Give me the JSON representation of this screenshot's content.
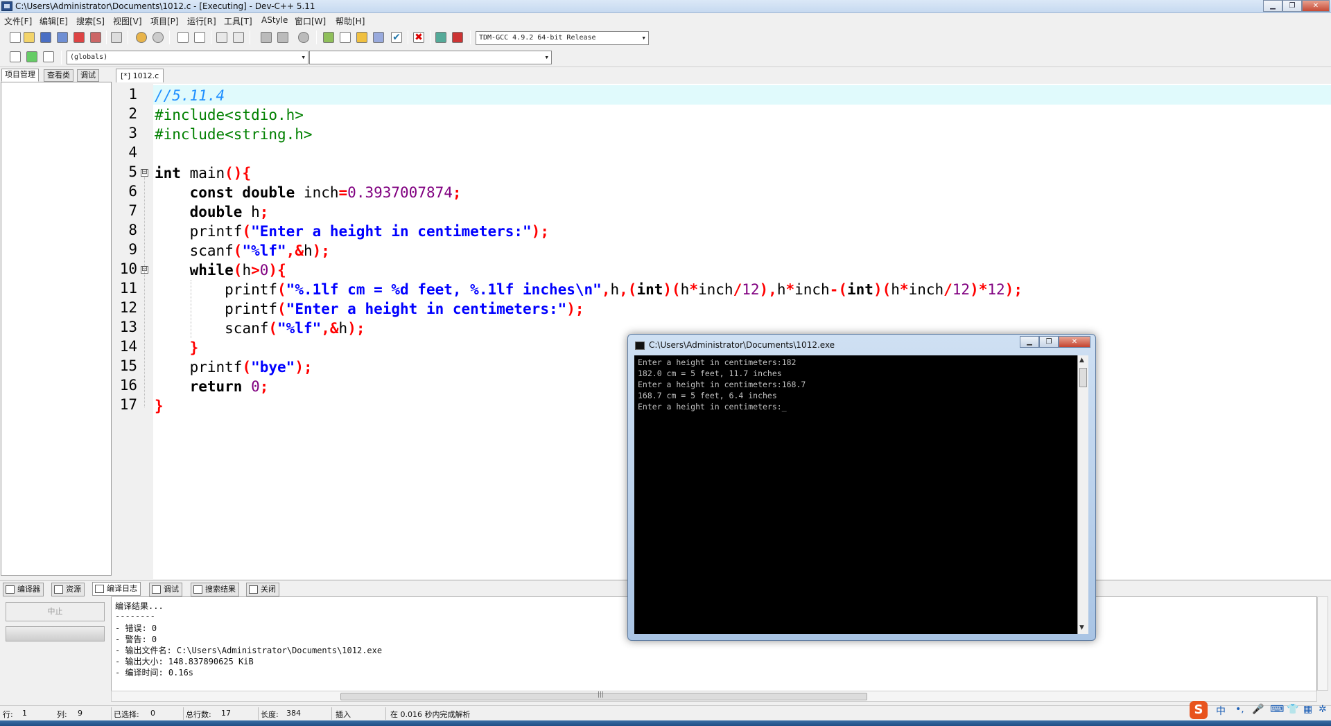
{
  "window": {
    "title": "C:\\Users\\Administrator\\Documents\\1012.c - [Executing] - Dev-C++ 5.11",
    "min_icon": "minimize-icon",
    "max_icon": "maximize-icon",
    "close_icon": "close-icon",
    "min_glyph": "▁",
    "max_glyph": "❐",
    "close_glyph": "✕"
  },
  "menu": [
    "文件[F]",
    "编辑[E]",
    "搜索[S]",
    "视图[V]",
    "项目[P]",
    "运行[R]",
    "工具[T]",
    "AStyle",
    "窗口[W]",
    "帮助[H]"
  ],
  "toolbar": {
    "compiler_select": "TDM-GCC 4.9.2 64-bit Release",
    "scope_select": "(globals)",
    "function_select": ""
  },
  "left_tabs": [
    "项目管理",
    "查看类",
    "调试"
  ],
  "editor": {
    "tab": "[*] 1012.c",
    "line_numbers": [
      "1",
      "2",
      "3",
      "4",
      "5",
      "6",
      "7",
      "8",
      "9",
      "10",
      "11",
      "12",
      "13",
      "14",
      "15",
      "16",
      "17"
    ],
    "fold_markers": [
      "⊟",
      "⊟"
    ],
    "code": {
      "l1": "//5.11.4",
      "l2": "#include<stdio.h>",
      "l3": "#include<string.h>",
      "l5a": "int",
      "l5b": " main",
      "l5c": "(){",
      "l6a": "const double",
      "l6b": " inch",
      "l6c": "=",
      "l6d": "0.3937007874",
      "l6e": ";",
      "l7a": "double",
      "l7b": " h",
      "l7c": ";",
      "l8a": "printf",
      "l8b": "(",
      "l8c": "\"Enter a height in centimeters:\"",
      "l8d": ");",
      "l9a": "scanf",
      "l9b": "(",
      "l9c": "\"%lf\"",
      "l9d": ",&",
      "l9e": "h",
      "l9f": ");",
      "l10a": "while",
      "l10b": "(",
      "l10c": "h",
      "l10d": ">",
      "l10e": "0",
      "l10f": "){",
      "l11a": "printf",
      "l11b": "(",
      "l11c": "\"%.1lf cm = %d feet, %.1lf inches\\n\"",
      "l11d": ",",
      "l11e": "h",
      "l11f": ",(",
      "l11g": "int",
      "l11h": ")(",
      "l11i": "h",
      "l11j": "*",
      "l11k": "inch",
      "l11l": "/",
      "l11m": "12",
      "l11n": "),",
      "l11o": "h",
      "l11p": "*",
      "l11q": "inch",
      "l11r": "-(",
      "l11s": "int",
      "l11t": ")(",
      "l11u": "h",
      "l11v": "*",
      "l11w": "inch",
      "l11x": "/",
      "l11y": "12",
      "l11z": ")*",
      "l11aa": "12",
      "l11ab": ");",
      "l12a": "printf",
      "l12b": "(",
      "l12c": "\"Enter a height in centimeters:\"",
      "l12d": ");",
      "l13a": "scanf",
      "l13b": "(",
      "l13c": "\"%lf\"",
      "l13d": ",&",
      "l13e": "h",
      "l13f": ");",
      "l14": "}",
      "l15a": "printf",
      "l15b": "(",
      "l15c": "\"bye\"",
      "l15d": ");",
      "l16a": "return",
      "l16b": " ",
      "l16c": "0",
      "l16d": ";",
      "l17": "}"
    }
  },
  "bottom_tabs": [
    "编译器",
    "资源",
    "编译日志",
    "调试",
    "搜索结果",
    "关闭"
  ],
  "bottom": {
    "stop_button": "中止",
    "log": [
      "编译结果...",
      "--------",
      "- 错误: 0",
      "- 警告: 0",
      "- 输出文件名: C:\\Users\\Administrator\\Documents\\1012.exe",
      "- 输出大小: 148.837890625 KiB",
      "- 编译时间: 0.16s"
    ],
    "hscroll_mark": "|||"
  },
  "status": {
    "row_label": "行:",
    "row": "1",
    "col_label": "列:",
    "col": "9",
    "sel_label": "已选择:",
    "sel": "0",
    "lines_label": "总行数:",
    "lines": "17",
    "len_label": "长度:",
    "len": "384",
    "mode": "插入",
    "parse": "在 0.016 秒内完成解析"
  },
  "console": {
    "title": "C:\\Users\\Administrator\\Documents\\1012.exe",
    "lines": [
      "Enter a height in centimeters:182",
      "182.0 cm = 5 feet, 11.7 inches",
      "Enter a height in centimeters:168.7",
      "168.7 cm = 5 feet, 6.4 inches",
      "Enter a height in centimeters:_"
    ],
    "scroll_up": "▲",
    "scroll_down": "▼"
  },
  "tray": {
    "ime_logo": "S",
    "ime_lang": "中"
  }
}
